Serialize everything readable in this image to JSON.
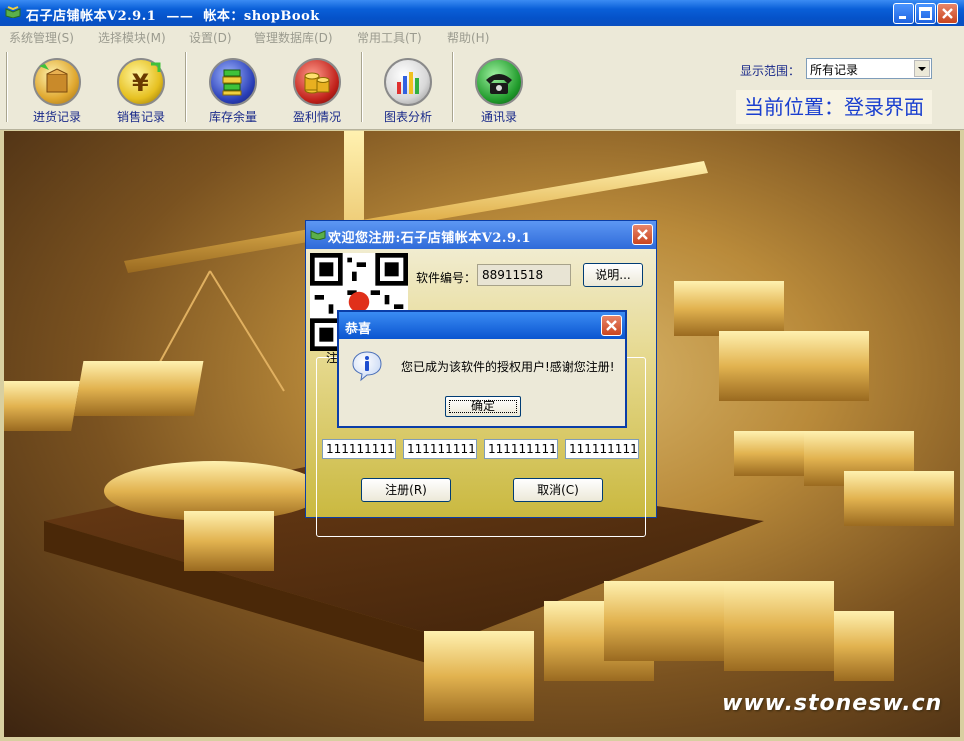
{
  "window": {
    "title": "石子店铺帐本V2.9.1  ——  帐本：shopBook"
  },
  "menu": {
    "items": [
      {
        "label": "系统管理(S)"
      },
      {
        "label": "选择模块(M)"
      },
      {
        "label": "设置(D)"
      },
      {
        "label": "管理数据库(D)"
      },
      {
        "label": "常用工具(T)"
      },
      {
        "label": "帮助(H)"
      }
    ]
  },
  "toolbar": {
    "buttons": [
      {
        "label": "进货记录",
        "icon": "purchase-box-icon"
      },
      {
        "label": "销售记录",
        "icon": "yen-coin-icon"
      },
      {
        "label": "库存余量",
        "icon": "inventory-books-icon"
      },
      {
        "label": "盈利情况",
        "icon": "coin-stack-icon"
      },
      {
        "label": "图表分析",
        "icon": "bar-chart-icon"
      },
      {
        "label": "通讯录",
        "icon": "telephone-icon"
      }
    ],
    "scope_label": "显示范围：",
    "scope_value": "所有记录",
    "location": "当前位置：登录界面"
  },
  "background": {
    "watermark": "www.stonesw.cn"
  },
  "register_dialog": {
    "title": "欢迎您注册:石子店铺帐本V2.9.1",
    "serial_label": "软件编号：",
    "serial_value": "88911518",
    "help_button": "说明...",
    "group_label": "注",
    "codes": [
      "111111111",
      "111111111",
      "111111111",
      "111111111"
    ],
    "register_button": "注册(R)",
    "cancel_button": "取消(C)"
  },
  "message_dialog": {
    "title": "恭喜",
    "text": "您已成为该软件的授权用户!感谢您注册!",
    "ok_button": "确定"
  },
  "colors": {
    "titlebar": "#0a55d0",
    "chrome": "#ece9d8",
    "link_text": "#1a2a8a",
    "location_text": "#1a3fcf"
  }
}
